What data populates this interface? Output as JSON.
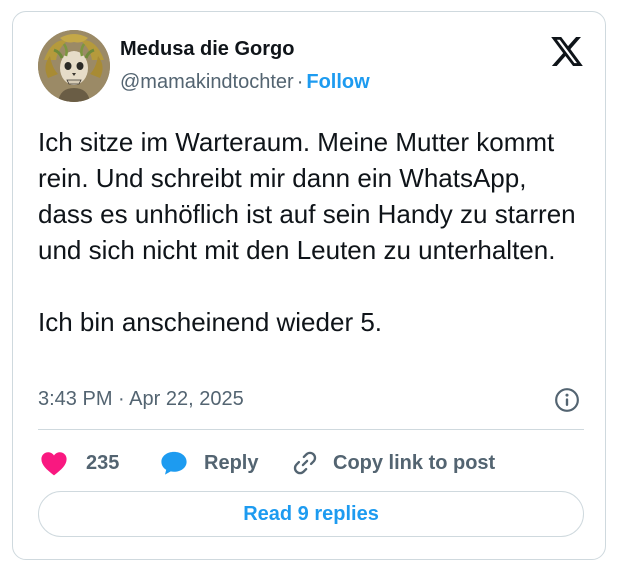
{
  "author": {
    "name": "Medusa die Gorgo",
    "handle": "@mamakindtochter",
    "separator": "·",
    "follow_label": "Follow",
    "avatar_icon": "medusa-avatar"
  },
  "tweet": {
    "text": "Ich sitze im Warteraum. Meine Mutter kommt rein. Und schreibt mir dann ein WhatsApp, dass es unhöflich ist auf sein Handy zu starren und sich nicht mit den Leuten zu unterhalten.\n\nIch bin anscheinend wieder 5.",
    "time": "3:43 PM",
    "date_separator": "·",
    "date": "Apr 22, 2025"
  },
  "actions": {
    "like_count": "235",
    "reply_label": "Reply",
    "copy_label": "Copy link to post"
  },
  "read_replies_label": "Read 9 replies",
  "icons": {
    "platform": "x-logo-icon",
    "info": "info-icon",
    "like": "heart-icon",
    "reply": "speech-bubble-icon",
    "copy": "link-icon"
  },
  "colors": {
    "accent": "#1d9bf0",
    "like": "#f91880",
    "text": "#0f1419",
    "secondary_text": "#536471",
    "border": "#cfd9de"
  }
}
